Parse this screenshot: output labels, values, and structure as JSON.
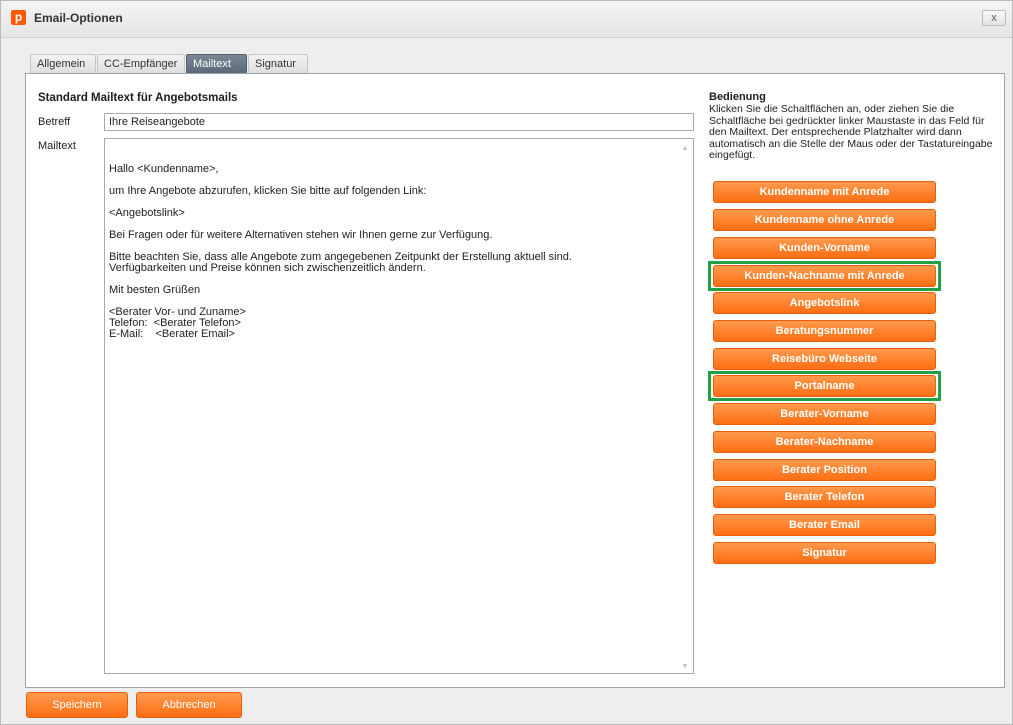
{
  "window": {
    "title": "Email-Optionen",
    "app_icon_letter": "p",
    "close_label": "x"
  },
  "tabs": [
    {
      "label": "Allgemein",
      "active": false
    },
    {
      "label": "CC-Empfänger",
      "active": false
    },
    {
      "label": "Mailtext",
      "active": true
    },
    {
      "label": "Signatur",
      "active": false
    }
  ],
  "form": {
    "section_title": "Standard Mailtext für Angebotsmails",
    "subject_label": "Betreff",
    "subject_value": "Ihre Reiseangebote",
    "body_label": "Mailtext",
    "body_value": "Hallo <Kundenname>,\n\num Ihre Angebote abzurufen, klicken Sie bitte auf folgenden Link:\n\n<Angebotslink>\n\nBei Fragen oder für weitere Alternativen stehen wir Ihnen gerne zur Verfügung.\n\nBitte beachten Sie, dass alle Angebote zum angegebenen Zeitpunkt der Erstellung aktuell sind.\nVerfügbarkeiten und Preise können sich zwischenzeitlich ändern.\n\nMit besten Grüßen\n\n<Berater Vor- und Zuname>\nTelefon:  <Berater Telefon>\nE-Mail:    <Berater Email>"
  },
  "controls": {
    "title": "Bedienung",
    "description": "Klicken Sie die Schaltflächen an, oder ziehen Sie die Schaltfläche bei gedrückter linker Maustaste in das Feld für den Mailtext. Der entsprechende Platzhalter wird dann automatisch an die Stelle der Maus oder der Tastatureingabe eingefügt.",
    "placeholders": [
      {
        "label": "Kundenname mit Anrede",
        "highlighted": false
      },
      {
        "label": "Kundenname ohne Anrede",
        "highlighted": false
      },
      {
        "label": "Kunden-Vorname",
        "highlighted": false
      },
      {
        "label": "Kunden-Nachname mit Anrede",
        "highlighted": true
      },
      {
        "label": "Angebotslink",
        "highlighted": false
      },
      {
        "label": "Beratungsnummer",
        "highlighted": false
      },
      {
        "label": "Reisebüro Webseite",
        "highlighted": false
      },
      {
        "label": "Portalname",
        "highlighted": true
      },
      {
        "label": "Berater-Vorname",
        "highlighted": false
      },
      {
        "label": "Berater-Nachname",
        "highlighted": false
      },
      {
        "label": "Berater Position",
        "highlighted": false
      },
      {
        "label": "Berater Telefon",
        "highlighted": false
      },
      {
        "label": "Berater Email",
        "highlighted": false
      },
      {
        "label": "Signatur",
        "highlighted": false
      }
    ]
  },
  "footer": {
    "save_label": "Speichern",
    "cancel_label": "Abbrechen"
  },
  "colors": {
    "accent_orange": "#ff7a1f",
    "highlight_green": "#21a045",
    "active_tab": "#5f6c7b"
  }
}
